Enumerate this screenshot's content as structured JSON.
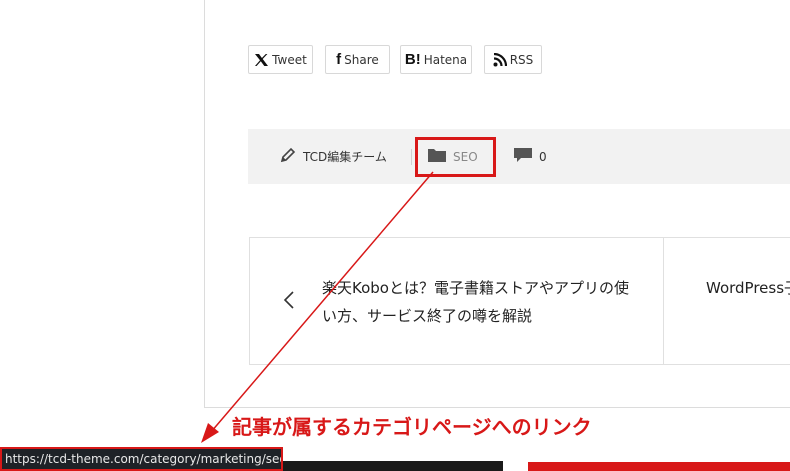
{
  "share": {
    "tweet": "Tweet",
    "share": "Share",
    "hatena_icon": "B!",
    "hatena": "Hatena",
    "rss": "RSS"
  },
  "meta": {
    "author": "TCD編集チーム",
    "category": "SEO",
    "comments": "0"
  },
  "post_nav": {
    "prev_title": "楽天Koboとは？電子書籍ストアやアプリの使い方、サービス終了の噂を解説",
    "next_title": "WordPress子を増やす"
  },
  "annotation": {
    "label": "記事が属するカテゴリページへのリンク",
    "color": "#d81818"
  },
  "status_bar": {
    "url": "https://tcd-theme.com/category/marketing/seo"
  }
}
